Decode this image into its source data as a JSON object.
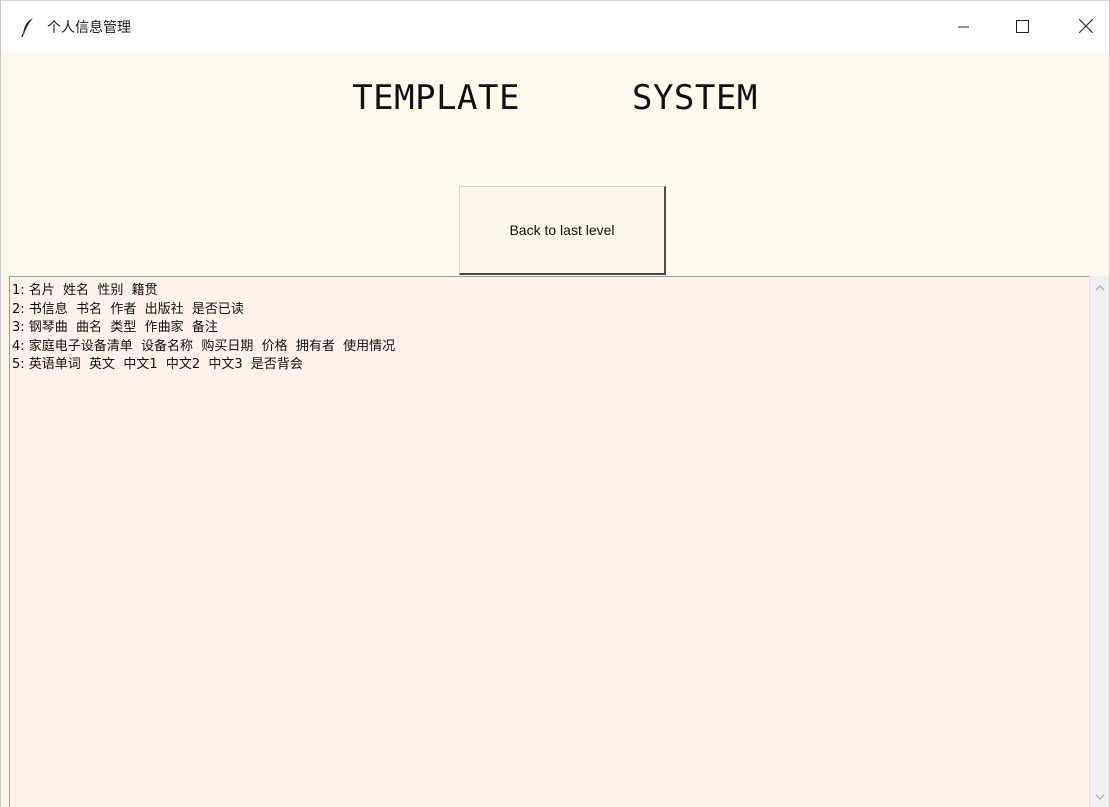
{
  "window": {
    "title": "个人信息管理",
    "icon": "feather-icon",
    "controls": {
      "minimize_icon": "minimize-icon",
      "maximize_icon": "maximize-icon",
      "close_icon": "close-icon"
    }
  },
  "header": {
    "word1": "TEMPLATE",
    "word2": "SYSTEM"
  },
  "actions": {
    "back_label": "Back to last level"
  },
  "list": {
    "items": [
      "1: 名片  姓名  性别  籍贯",
      "2: 书信息  书名  作者  出版社  是否已读",
      "3: 钢琴曲  曲名  类型  作曲家  备注",
      "4: 家庭电子设备清单  设备名称  购买日期  价格  拥有者  使用情况",
      "5: 英语单词  英文  中文1  中文2  中文3  是否背会"
    ]
  },
  "colors": {
    "window_bg": "#fdf9ef",
    "list_bg": "#fff1ec",
    "titlebar_bg": "#ffffff"
  }
}
